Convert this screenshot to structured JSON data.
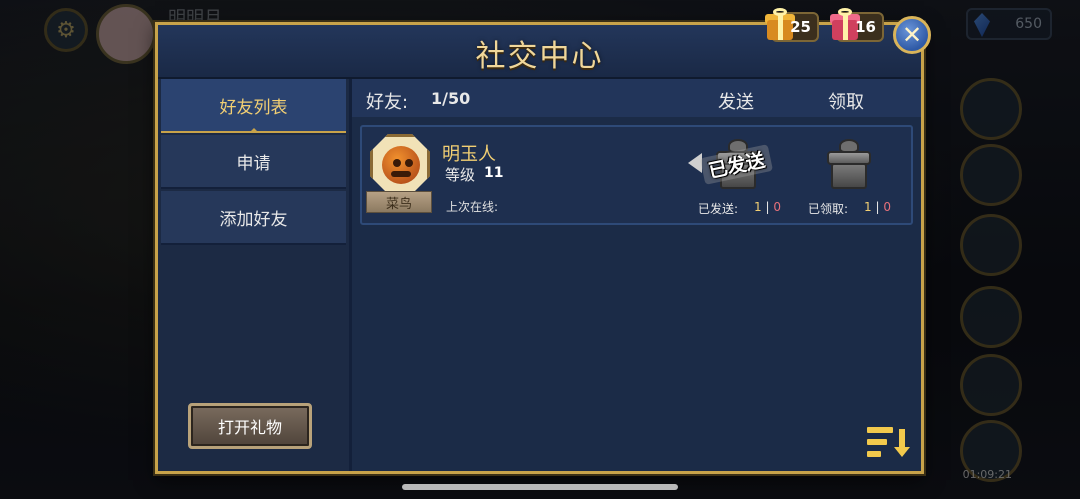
{
  "background": {
    "player_name": "明明月",
    "crystal_count": "650",
    "time": "01:09:21"
  },
  "dialog": {
    "title": "社交中心",
    "close_symbol": "✕",
    "gift_counters": [
      {
        "count": "25",
        "color": "#e8a531"
      },
      {
        "count": "16",
        "color": "#e04a6a"
      }
    ]
  },
  "tabs": [
    {
      "label": "好友列表",
      "active": true
    },
    {
      "label": "申请",
      "active": false
    },
    {
      "label": "添加好友",
      "active": false
    }
  ],
  "open_gift_button": "打开礼物",
  "list_header": {
    "friends_label": "好友:",
    "friends_count": "1/50",
    "send_label": "发送",
    "receive_label": "领取"
  },
  "friends": [
    {
      "name": "明玉人",
      "level_label": "等级",
      "level_value": "11",
      "rank_title": "菜鸟",
      "last_online_label": "上次在线:",
      "sent_stamp": "已发送",
      "sent_label": "已发送:",
      "sent_a": "1",
      "sent_sep": "|",
      "sent_b": "0",
      "received_label": "已领取:",
      "received_a": "1",
      "received_sep": "|",
      "received_b": "0"
    }
  ],
  "colors": {
    "accent_gold": "#f2cf73",
    "frame_gold": "#c8a34a",
    "panel_blue": "#1b2b47"
  }
}
